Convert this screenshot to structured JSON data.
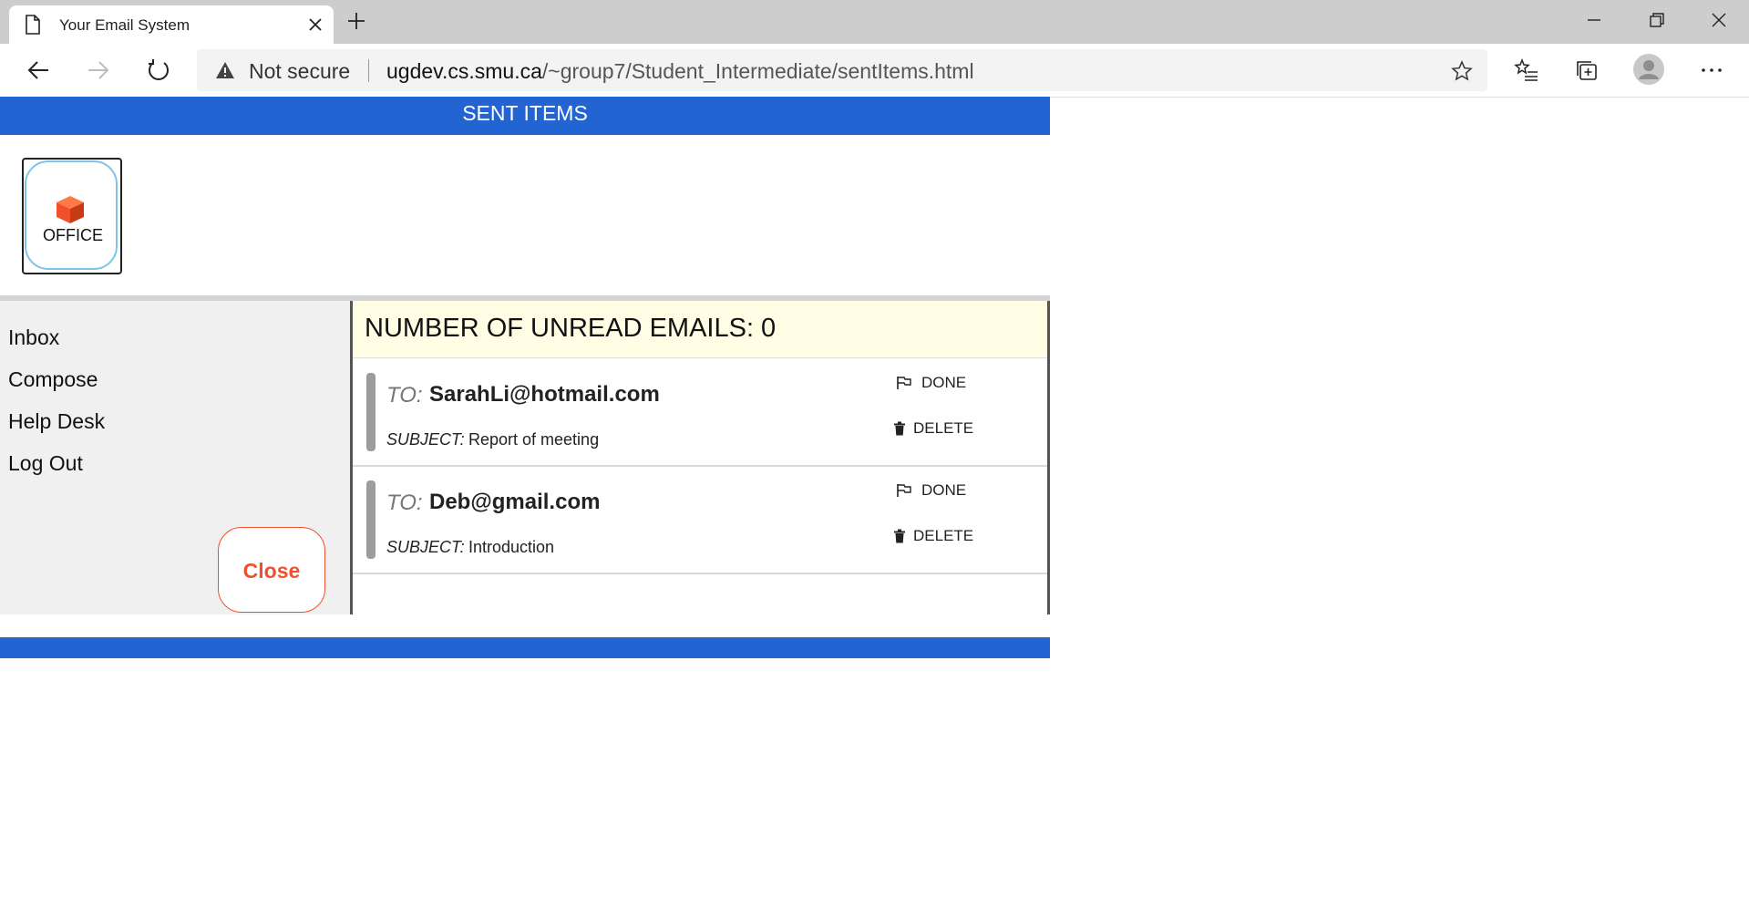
{
  "browser": {
    "tab_title": "Your Email System",
    "not_secure_label": "Not secure",
    "url_host": "ugdev.cs.smu.ca",
    "url_path": "/~group7/Student_Intermediate/sentItems.html"
  },
  "header": {
    "title": "SENT ITEMS"
  },
  "office": {
    "label": "OFFICE",
    "icon": "cube-icon",
    "icon_color": "#f0502b"
  },
  "sidebar": {
    "items": [
      {
        "label": "Inbox"
      },
      {
        "label": "Compose"
      },
      {
        "label": "Help Desk"
      },
      {
        "label": "Log Out"
      }
    ],
    "close_label": "Close"
  },
  "main": {
    "unread_label": "NUMBER OF UNREAD EMAILS: 0",
    "to_prefix": "TO:",
    "subject_prefix": "SUBJECT:",
    "done_label": "DONE",
    "delete_label": "DELETE",
    "emails": [
      {
        "to": "SarahLi@hotmail.com",
        "subject": "Report of meeting"
      },
      {
        "to": "Deb@gmail.com",
        "subject": "Introduction"
      }
    ]
  },
  "colors": {
    "brand_blue": "#2264d1",
    "accent_orange": "#f0502b",
    "unread_bg": "#fffde3",
    "sidebar_bg": "#f0f0f0"
  }
}
